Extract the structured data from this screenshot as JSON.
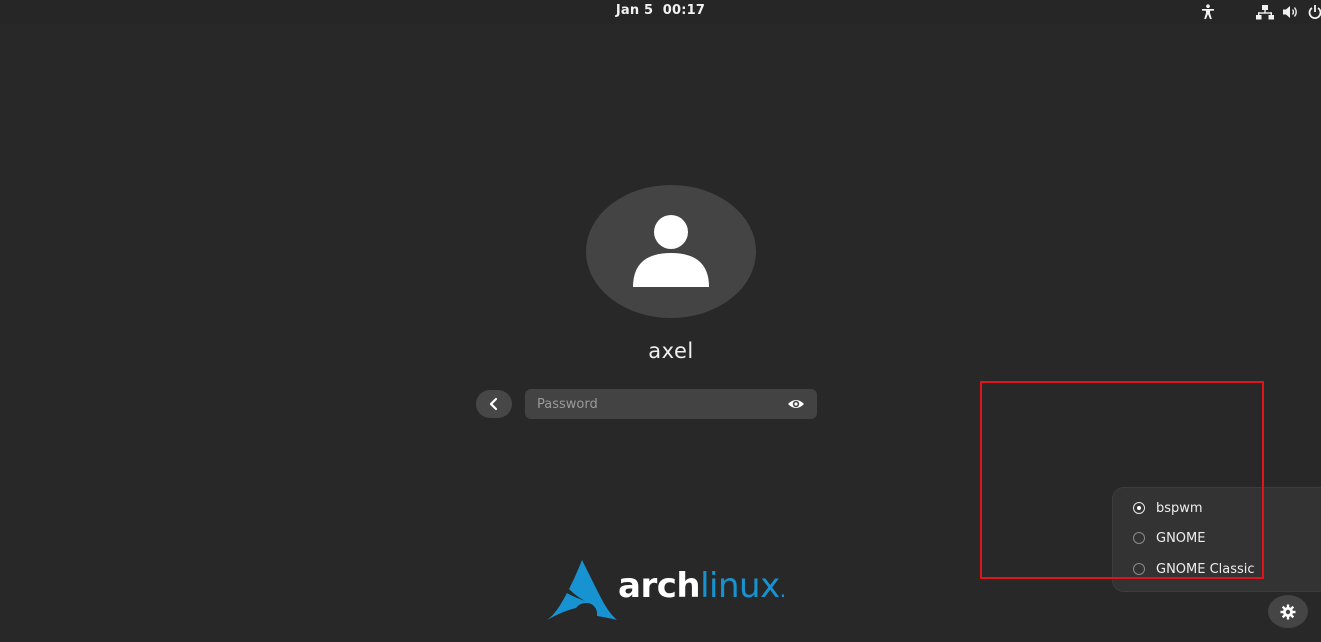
{
  "topbar": {
    "date": "Jan 5",
    "time": "00:17",
    "icons": [
      "accessibility-icon",
      "network-icon",
      "volume-icon",
      "power-icon"
    ]
  },
  "login": {
    "username": "axel",
    "password_placeholder": "Password",
    "back_icon": "chevron-left-icon",
    "reveal_icon": "eye-icon"
  },
  "session_menu": {
    "items": [
      {
        "label": "bspwm",
        "selected": true
      },
      {
        "label": "GNOME",
        "selected": false
      },
      {
        "label": "GNOME Classic",
        "selected": false
      }
    ]
  },
  "logo": {
    "part1": "arch",
    "part2": "linux",
    "part3": "."
  },
  "colors": {
    "background": "#282828",
    "arch_blue": "#1793d1",
    "highlight": "#e0141a"
  }
}
